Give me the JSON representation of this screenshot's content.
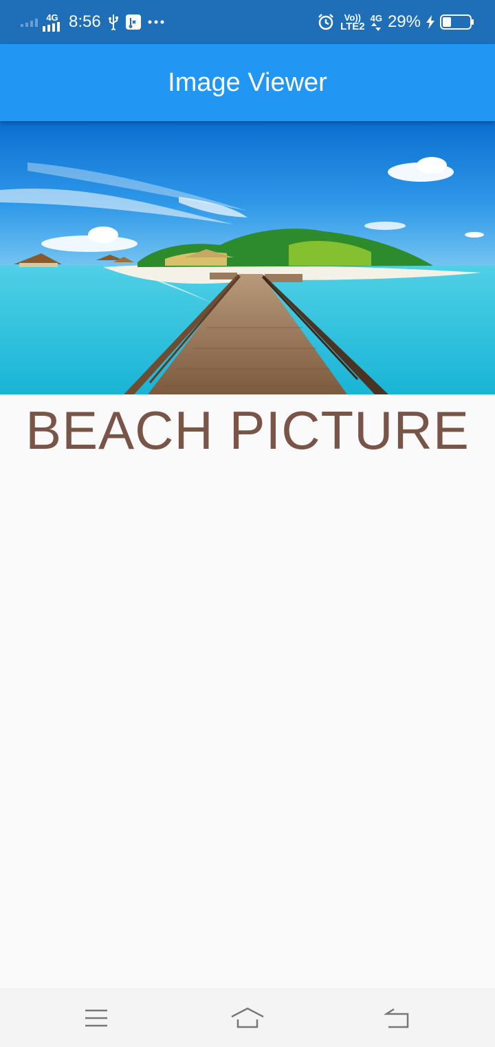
{
  "status_bar": {
    "network_left": "4G",
    "time": "8:56",
    "volte_top": "Vo))",
    "volte_bottom": "LTE2",
    "network_right": "4G",
    "battery": "29%"
  },
  "app_bar": {
    "title": "Image Viewer"
  },
  "content": {
    "caption": "BEACH PICTURE"
  },
  "icons": {
    "status": [
      "signal-icon",
      "usb-icon",
      "usb-debug-icon",
      "more-icon",
      "alarm-icon",
      "charging-icon",
      "battery-icon"
    ],
    "nav": [
      "menu-icon",
      "home-icon",
      "back-icon"
    ]
  },
  "colors": {
    "status_bar": "#1e6fb8",
    "app_bar": "#2196f3",
    "caption": "#795548",
    "background": "#fafafa"
  }
}
